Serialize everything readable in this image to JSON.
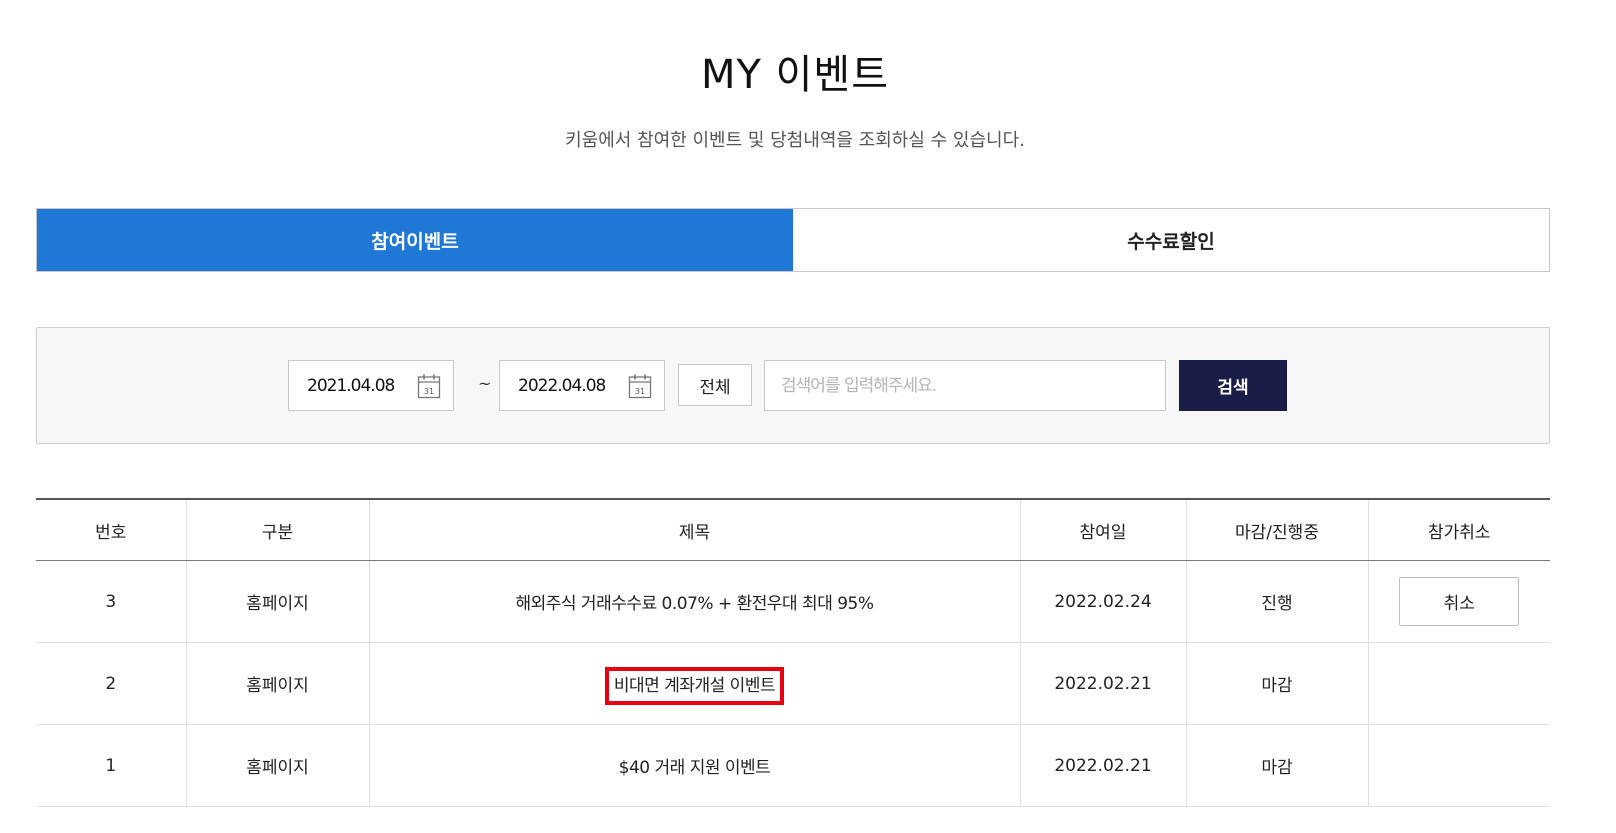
{
  "header": {
    "title": "MY 이벤트",
    "subtitle": "키움에서 참여한 이벤트 및 당첨내역을 조회하실 수 있습니다."
  },
  "tabs": [
    {
      "label": "참여이벤트",
      "active": true
    },
    {
      "label": "수수료할인",
      "active": false
    }
  ],
  "search": {
    "start_date": "2021.04.08",
    "end_date": "2022.04.08",
    "calendar_icon_text": "31",
    "separator": "~",
    "all_label": "전체",
    "placeholder": "검색어를 입력해주세요.",
    "button_label": "검색"
  },
  "table": {
    "headers": [
      "번호",
      "구분",
      "제목",
      "참여일",
      "마감/진행중",
      "참가취소"
    ],
    "rows": [
      {
        "no": "3",
        "category": "홈페이지",
        "title": "해외주식 거래수수료 0.07% + 환전우대 최대 95%",
        "date": "2022.02.24",
        "status": "진행",
        "cancel": "취소"
      },
      {
        "no": "2",
        "category": "홈페이지",
        "title": "비대면 계좌개설 이벤트",
        "date": "2022.02.21",
        "status": "마감",
        "cancel": ""
      },
      {
        "no": "1",
        "category": "홈페이지",
        "title": "$40 거래 지원 이벤트",
        "date": "2022.02.21",
        "status": "마감",
        "cancel": ""
      }
    ]
  },
  "colors": {
    "active_tab": "#1f78d6",
    "search_button": "#1a1d47",
    "highlight_box": "#e60012"
  }
}
